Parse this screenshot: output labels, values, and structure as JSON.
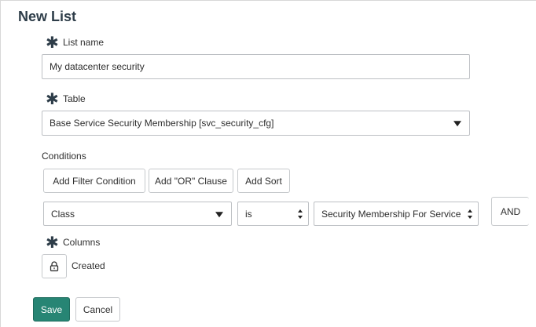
{
  "page": {
    "title": "New List"
  },
  "list_name": {
    "label": "List name",
    "value": "My datacenter security"
  },
  "table": {
    "label": "Table",
    "selected": "Base Service Security Membership [svc_security_cfg]"
  },
  "conditions": {
    "label": "Conditions",
    "buttons": {
      "add_filter": "Add Filter Condition",
      "add_or": "Add \"OR\" Clause",
      "add_sort": "Add Sort"
    },
    "row": {
      "field": "Class",
      "operator": "is",
      "value": "Security Membership For Service L",
      "connector": "AND"
    }
  },
  "columns": {
    "label": "Columns",
    "items": [
      "Created"
    ]
  },
  "actions": {
    "save": "Save",
    "cancel": "Cancel"
  },
  "colors": {
    "primary": "#278574"
  }
}
